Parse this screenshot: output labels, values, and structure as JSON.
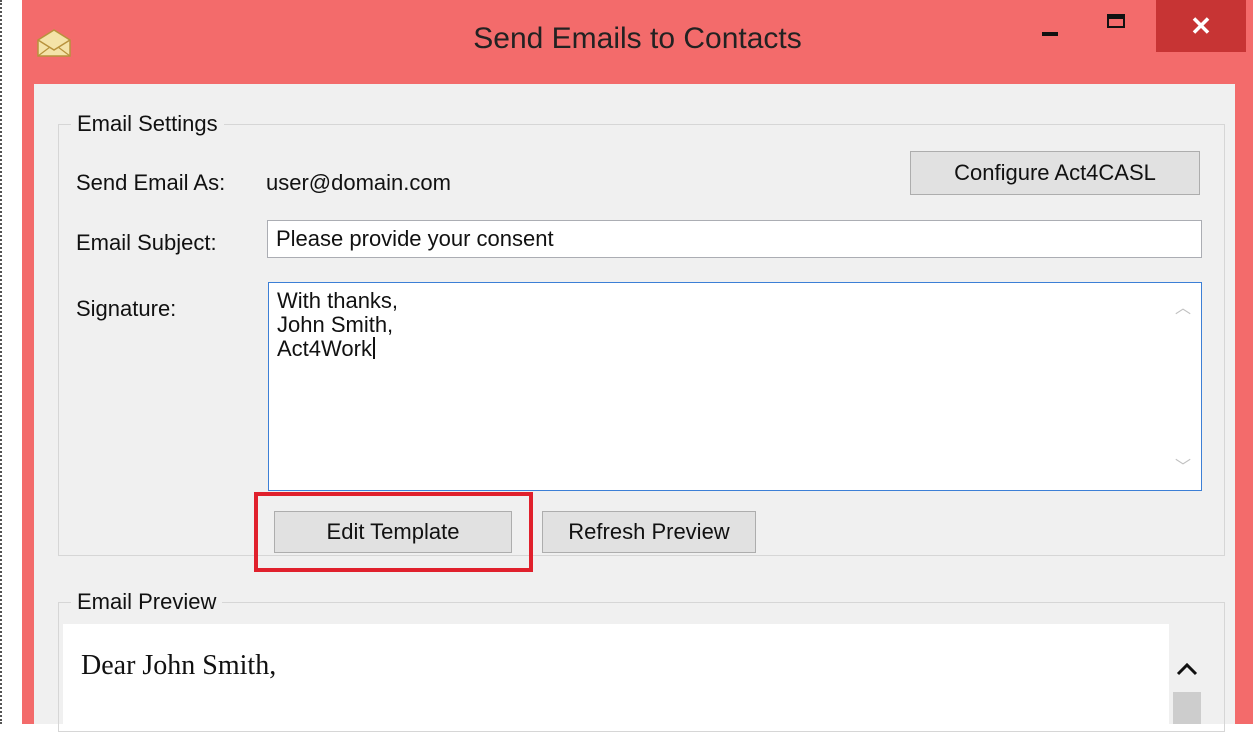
{
  "window": {
    "title": "Send Emails to Contacts",
    "close_glyph": "✕",
    "frame_color": "#f36b6b",
    "close_color": "#c73434"
  },
  "settings": {
    "group_label": "Email Settings",
    "send_as_label": "Send Email As:",
    "send_as_value": "user@domain.com",
    "configure_button": "Configure Act4CASL",
    "subject_label": "Email Subject:",
    "subject_value": "Please provide your consent",
    "signature_label": "Signature:",
    "signature_value": "With thanks,\nJohn Smith,\nAct4Work",
    "edit_template_button": "Edit Template",
    "refresh_preview_button": "Refresh Preview",
    "highlight_color": "#e0202c"
  },
  "preview": {
    "group_label": "Email Preview",
    "body_text": "Dear John Smith,"
  }
}
